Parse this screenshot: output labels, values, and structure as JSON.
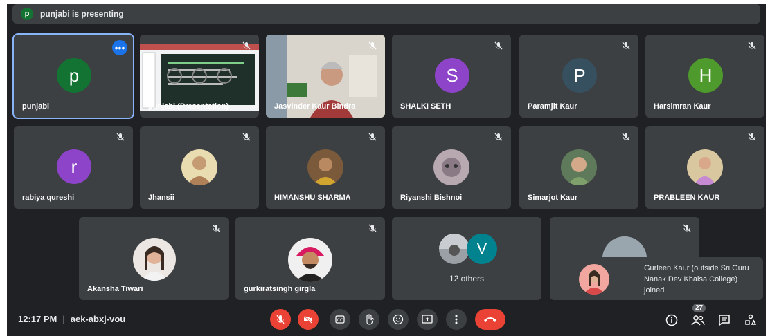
{
  "banner": {
    "avatar_letter": "p",
    "text": "punjabi is presenting"
  },
  "tiles": [
    {
      "name": "punjabi",
      "letter": "p",
      "color": "#137333"
    },
    {
      "name": "punjabi (Presentation)"
    },
    {
      "name": "Jasvinder Kaur Bindra"
    },
    {
      "name": "SHALKI SETH",
      "letter": "S",
      "color": "#8e44c9"
    },
    {
      "name": "Paramjit Kaur",
      "letter": "P",
      "color": "#37505f"
    },
    {
      "name": "Harsimran Kaur",
      "letter": "H",
      "color": "#4e9a2c"
    },
    {
      "name": "rabiya qureshi",
      "letter": "r",
      "color": "#8e44c9"
    },
    {
      "name": "Jhansii"
    },
    {
      "name": "HIMANSHU SHARMA"
    },
    {
      "name": "Riyanshi Bishnoi"
    },
    {
      "name": "Simarjot Kaur"
    },
    {
      "name": "PRABLEEN KAUR"
    },
    {
      "name": "Akansha Tiwari"
    },
    {
      "name": "gurkiratsingh girgla"
    },
    {
      "name": "12 others",
      "letter": "V",
      "color": "#00838f"
    }
  ],
  "toast": {
    "text": "Gurleen Kaur (outside Sri Guru Nanak Dev Khalsa College) joined"
  },
  "bottom": {
    "time": "12:17 PM",
    "separator": "|",
    "meeting_code": "aek-abxj-vou",
    "participants_count": "27"
  },
  "colors": {
    "background": "#202124",
    "tile": "#3c4043",
    "accent": "#1a73e8",
    "danger": "#ea4335"
  },
  "icons": [
    "mic-off-icon",
    "camera-off-icon",
    "captions-icon",
    "raise-hand-icon",
    "emoji-icon",
    "present-icon",
    "more-options-icon",
    "end-call-icon",
    "info-icon",
    "people-icon",
    "chat-icon",
    "activities-icon"
  ]
}
